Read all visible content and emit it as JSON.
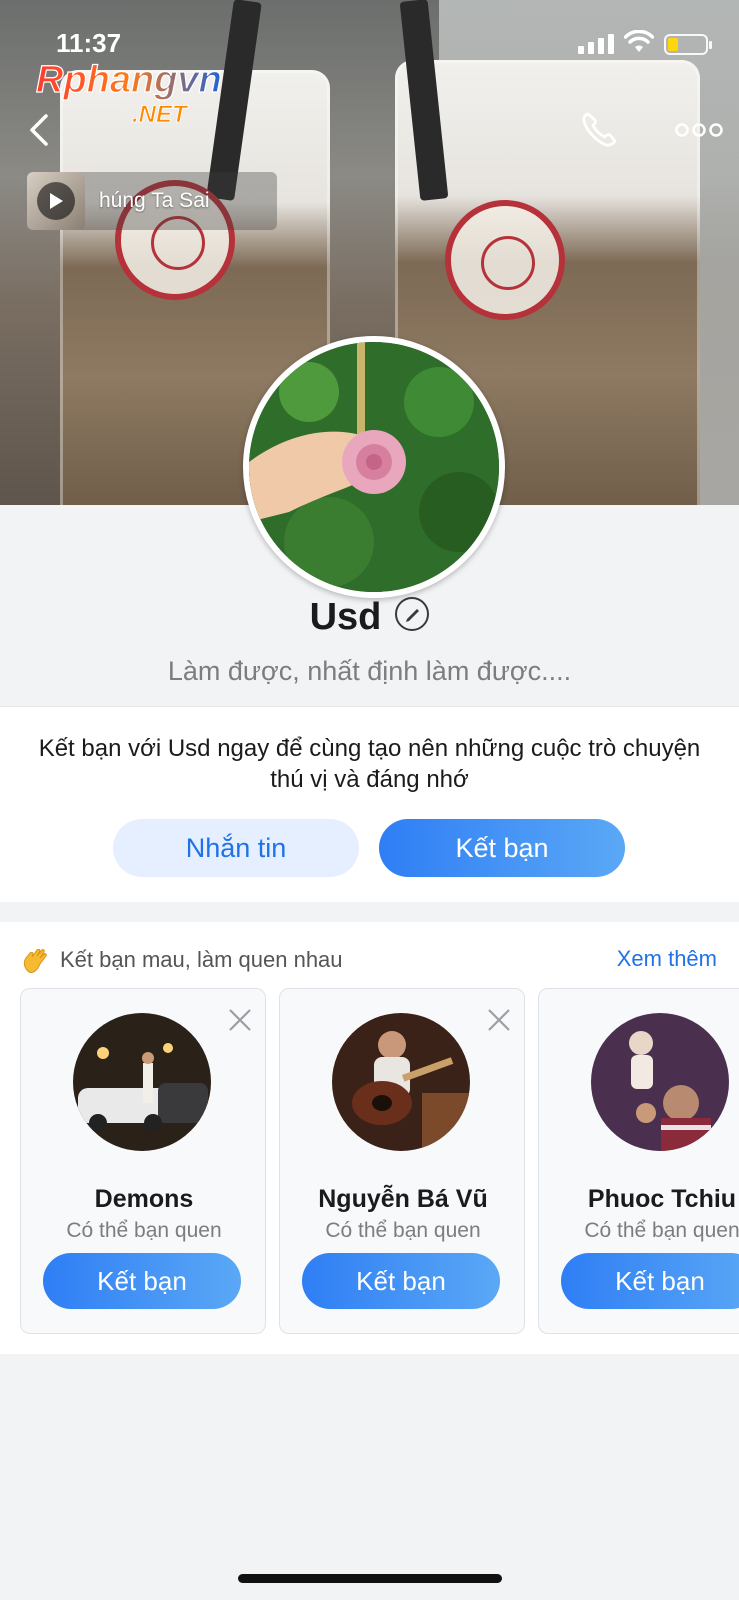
{
  "status_bar": {
    "time": "11:37"
  },
  "watermark": {
    "line1": "Rphangvn",
    "line2": ".NET"
  },
  "nav": {
    "back_icon": "chevron-left-icon",
    "call_icon": "phone-icon",
    "more_icon": "more-dots-icon"
  },
  "music": {
    "title": "húng Ta Sai"
  },
  "profile": {
    "name": "Usd",
    "status": "Làm được, nhất định làm được...."
  },
  "prompt": {
    "text": "Kết bạn với Usd ngay để cùng tạo nên những cuộc trò chuyện thú vị và đáng nhớ",
    "message_label": "Nhắn tin",
    "add_friend_label": "Kết bạn"
  },
  "suggestions": {
    "heading": "Kết bạn mau, làm quen nhau",
    "see_more": "Xem thêm",
    "cards": [
      {
        "name": "Demons",
        "subtitle": "Có thể bạn quen",
        "button": "Kết bạn"
      },
      {
        "name": "Nguyễn Bá Vũ",
        "subtitle": "Có thể bạn quen",
        "button": "Kết bạn"
      },
      {
        "name": "Phuoc Tchiu",
        "subtitle": "Có thể bạn quen",
        "button": "Kết bạn"
      }
    ]
  },
  "colors": {
    "accent": "#1f73e6",
    "button_gradient_start": "#2f7ef5",
    "button_gradient_end": "#5aa8f5",
    "light_button": "#e5efff"
  }
}
